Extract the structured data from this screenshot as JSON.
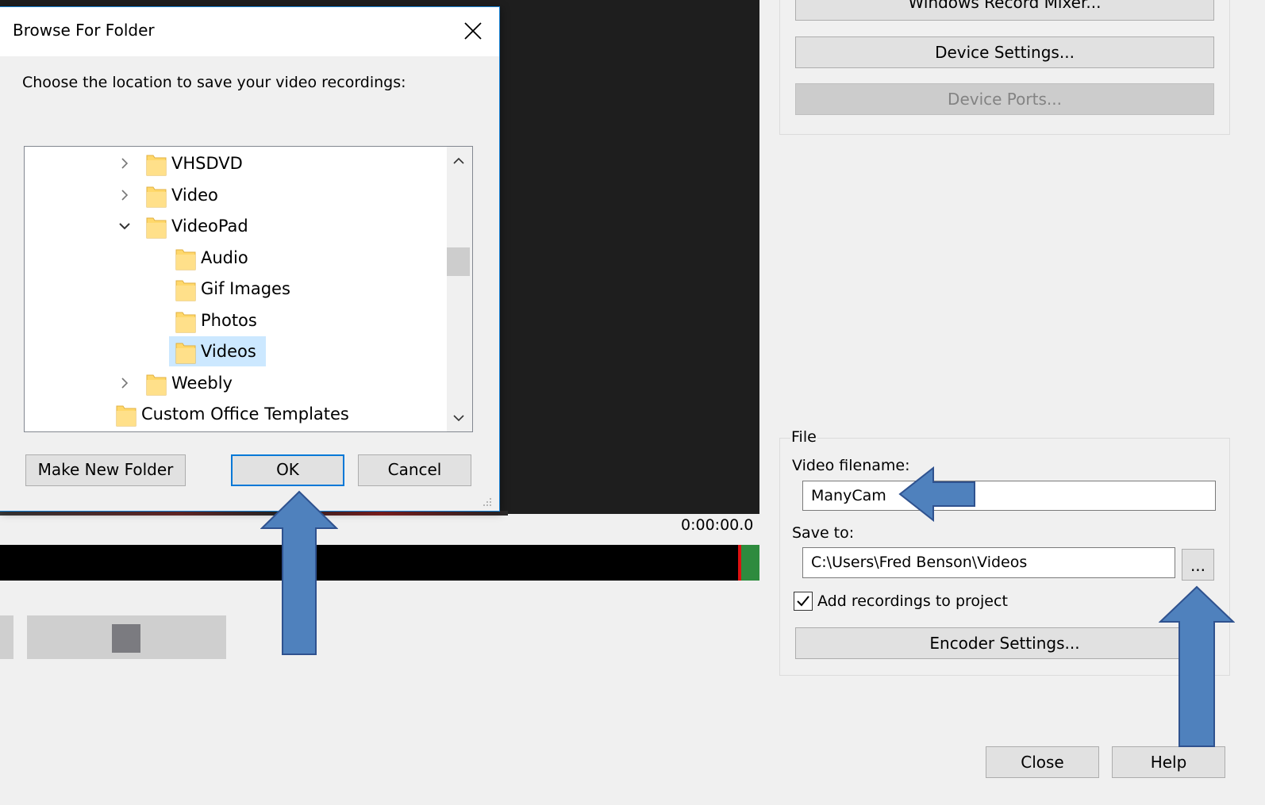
{
  "app": {
    "timecode": "0:00:00.0",
    "device_buttons": {
      "record_mixer": "Windows Record Mixer...",
      "device_settings": "Device Settings...",
      "device_ports": "Device Ports..."
    },
    "file_group": {
      "legend": "File",
      "video_filename_label": "Video filename:",
      "video_filename_value": "ManyCam",
      "save_to_label": "Save to:",
      "save_to_value": "C:\\Users\\Fred Benson\\Videos",
      "browse_label": "...",
      "add_recordings_label": "Add recordings to project",
      "add_recordings_checked": true,
      "encoder_settings": "Encoder Settings..."
    },
    "close_button": "Close",
    "help_button": "Help"
  },
  "dialog": {
    "title": "Browse For Folder",
    "prompt": "Choose the location to save your video recordings:",
    "tree": [
      {
        "label": "VHSDVD",
        "level": 1,
        "expander": "collapsed",
        "selected": false
      },
      {
        "label": "Video",
        "level": 1,
        "expander": "collapsed",
        "selected": false
      },
      {
        "label": "VideoPad",
        "level": 1,
        "expander": "expanded",
        "selected": false
      },
      {
        "label": "Audio",
        "level": 2,
        "expander": "none",
        "selected": false
      },
      {
        "label": "Gif Images",
        "level": 2,
        "expander": "none",
        "selected": false
      },
      {
        "label": "Photos",
        "level": 2,
        "expander": "none",
        "selected": false
      },
      {
        "label": "Videos",
        "level": 2,
        "expander": "none",
        "selected": true
      },
      {
        "label": "Weebly",
        "level": 1,
        "expander": "collapsed",
        "selected": false
      },
      {
        "label": "Custom Office Templates",
        "level": 0,
        "expander": "none",
        "selected": false
      }
    ],
    "buttons": {
      "make_new_folder": "Make New Folder",
      "ok": "OK",
      "cancel": "Cancel"
    }
  },
  "colors": {
    "accent_blue": "#0078d7",
    "selection": "#cce8ff",
    "annotation_arrow_fill": "#4f81bd",
    "annotation_arrow_stroke": "#2f528f",
    "folder_yellow": "#ffd86b",
    "timeline_green": "#2e8b3e"
  },
  "icons": {
    "close": "close-icon",
    "folder": "folder-icon",
    "chevron_right": "chevron-right-icon",
    "chevron_down": "chevron-down-icon",
    "stop": "stop-icon",
    "resize_grip": "resize-grip-icon"
  }
}
